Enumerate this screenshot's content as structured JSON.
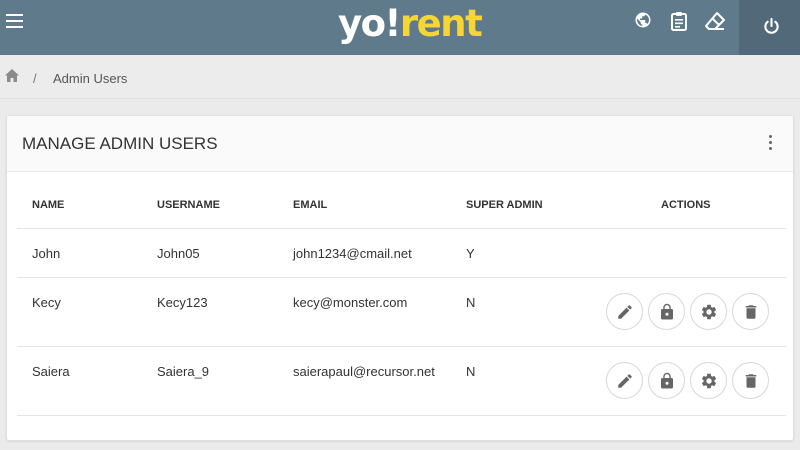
{
  "header": {
    "logo_part1": "yo!",
    "logo_part2": "rent",
    "icons": [
      "menu-icon",
      "globe-icon",
      "clipboard-icon",
      "eraser-icon",
      "power-icon"
    ]
  },
  "breadcrumb": {
    "separator": "/",
    "current": "Admin Users"
  },
  "page": {
    "title": "MANAGE ADMIN USERS"
  },
  "table": {
    "columns": [
      "NAME",
      "USERNAME",
      "EMAIL",
      "SUPER ADMIN",
      "ACTIONS"
    ],
    "rows": [
      {
        "name": "John",
        "username": "John05",
        "email": "john1234@cmail.net",
        "super_admin": "Y"
      },
      {
        "name": "Kecy",
        "username": "Kecy123",
        "email": "kecy@monster.com",
        "super_admin": "N"
      },
      {
        "name": "Saiera",
        "username": "Saiera_9",
        "email": "saierapaul@recursor.net",
        "super_admin": "N"
      }
    ],
    "row_actions": [
      "edit-icon",
      "lock-icon",
      "settings-icon",
      "delete-icon"
    ]
  },
  "colors": {
    "header_bg": "#5f7b8b",
    "power_bg": "#52697a",
    "logo_accent": "#f6d535"
  }
}
